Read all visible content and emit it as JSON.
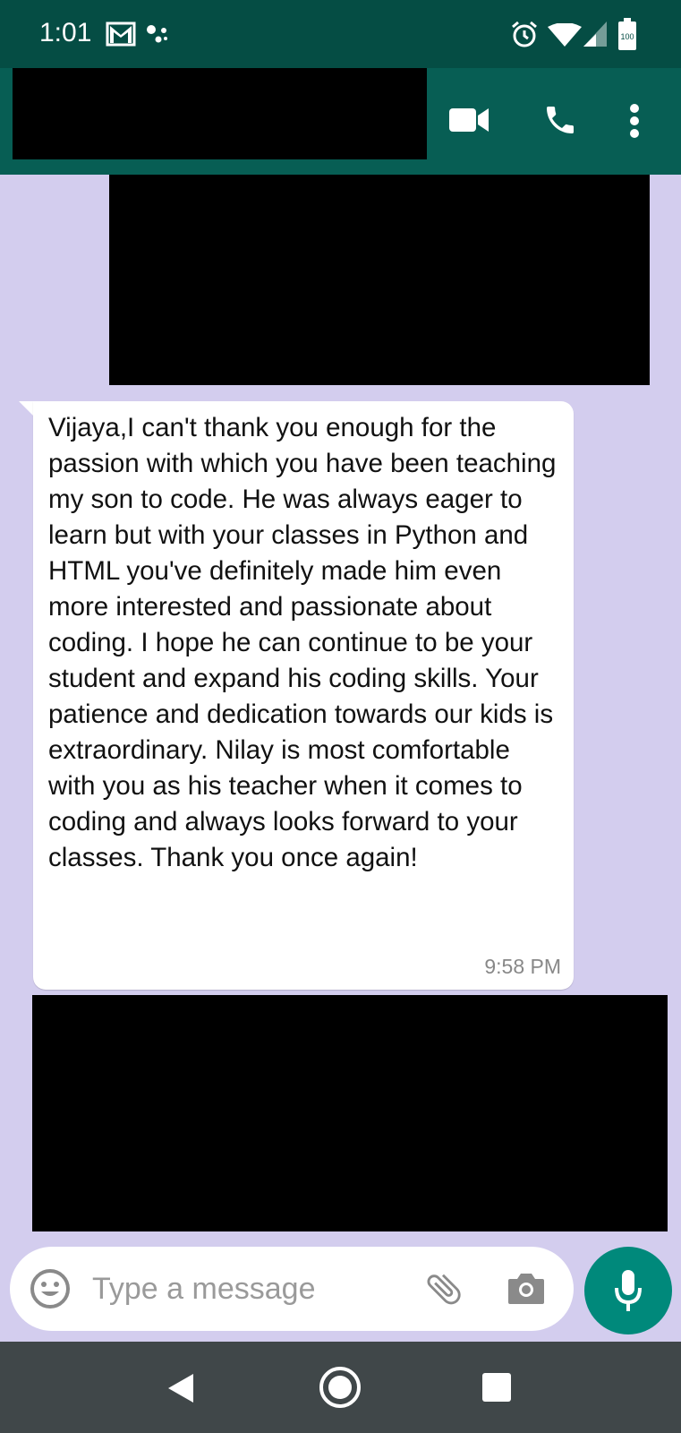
{
  "status_bar": {
    "time": "1:01",
    "icons": [
      "gmail-icon",
      "dots-icon",
      "alarm-icon",
      "wifi-icon",
      "signal-icon",
      "battery-icon"
    ],
    "battery_level": "100"
  },
  "app_bar": {
    "contact_name": "",
    "actions": [
      "video-call-icon",
      "phone-icon",
      "more-options-icon"
    ],
    "color": "#075e54"
  },
  "chat": {
    "background": "#d3cdee",
    "message": {
      "text": "Vijaya,I can't thank you enough for the passion with which you have been teaching my son to code. He was always eager to learn but with your classes in Python and HTML you've definitely made him even more interested and passionate about coding. I hope he can continue to be your student and expand his coding skills. Your patience and dedication towards our kids is extraordinary. Nilay is most comfortable with you as his teacher when it comes to coding and always looks forward to your classes. Thank you once again!",
      "time": "9:58 PM"
    }
  },
  "composer": {
    "placeholder": "Type a message",
    "value": "",
    "icons": [
      "emoji-icon",
      "attach-icon",
      "camera-icon",
      "mic-icon"
    ]
  },
  "nav_bar": {
    "buttons": [
      "back-icon",
      "home-icon",
      "recents-icon"
    ]
  }
}
